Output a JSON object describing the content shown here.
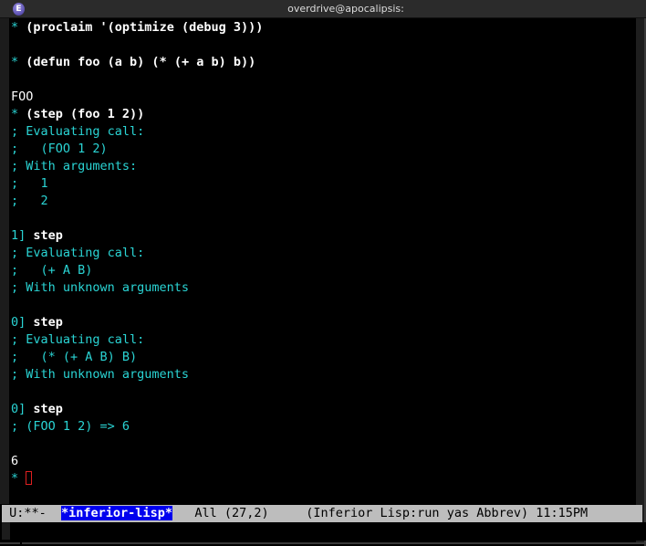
{
  "window": {
    "title": "overdrive@apocalipsis:",
    "icon": "emacs-icon",
    "icon_glyph": "E"
  },
  "buffer": {
    "lines": [
      {
        "type": "input",
        "prompt": "* ",
        "text": "(proclaim '(optimize (debug 3)))"
      },
      {
        "type": "blank"
      },
      {
        "type": "input",
        "prompt": "* ",
        "text": "(defun foo (a b) (* (+ a b) b))"
      },
      {
        "type": "blank"
      },
      {
        "type": "output",
        "text": "FOO"
      },
      {
        "type": "input",
        "prompt": "* ",
        "text": "(step (foo 1 2))"
      },
      {
        "type": "comment",
        "text": "; Evaluating call:"
      },
      {
        "type": "comment",
        "text": ";   (FOO 1 2)"
      },
      {
        "type": "comment",
        "text": "; With arguments:"
      },
      {
        "type": "comment",
        "text": ";   1"
      },
      {
        "type": "comment",
        "text": ";   2"
      },
      {
        "type": "blank"
      },
      {
        "type": "input",
        "prompt": "1] ",
        "text": "step"
      },
      {
        "type": "comment",
        "text": "; Evaluating call:"
      },
      {
        "type": "comment",
        "text": ";   (+ A B)"
      },
      {
        "type": "comment",
        "text": "; With unknown arguments"
      },
      {
        "type": "blank"
      },
      {
        "type": "input",
        "prompt": "0] ",
        "text": "step"
      },
      {
        "type": "comment",
        "text": "; Evaluating call:"
      },
      {
        "type": "comment",
        "text": ";   (* (+ A B) B)"
      },
      {
        "type": "comment",
        "text": "; With unknown arguments"
      },
      {
        "type": "blank"
      },
      {
        "type": "input",
        "prompt": "0] ",
        "text": "step"
      },
      {
        "type": "comment",
        "text": "; (FOO 1 2) => 6"
      },
      {
        "type": "blank"
      },
      {
        "type": "output",
        "text": "6"
      },
      {
        "type": "cursor",
        "prompt": "* ",
        "text": ""
      }
    ]
  },
  "modeline": {
    "status": " U:**-  ",
    "buffer_name": "*inferior-lisp*",
    "position": "   All (27,2)     ",
    "modes": "(Inferior Lisp:run yas Abbrev)",
    "time": " 11:15PM"
  },
  "colors": {
    "prompt": "#2ad4d4",
    "comment": "#2ad4d4",
    "modeline_bg": "#bdbdbd",
    "buffer_name_bg": "#0000ee",
    "cursor": "#e02020"
  }
}
